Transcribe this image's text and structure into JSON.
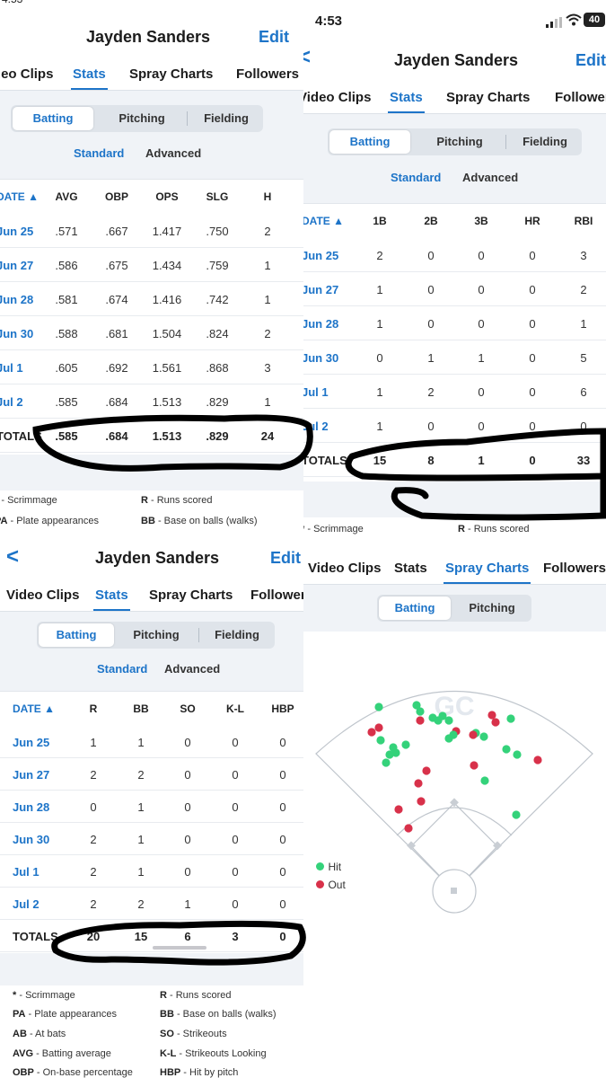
{
  "player_name": "Jayden Sanders",
  "edit_label": "Edit",
  "back_label": "<",
  "status_time": "4:53",
  "battery": "40",
  "tabs": [
    "Video Clips",
    "Stats",
    "Spray Charts",
    "Followers"
  ],
  "seg": [
    "Batting",
    "Pitching",
    "Fielding"
  ],
  "subtabs": [
    "Standard",
    "Advanced"
  ],
  "date_header": "DATE ▲",
  "totals_label": "TOTALS",
  "dates": [
    "Jun 25",
    "Jun 27",
    "Jun 28",
    "Jun 30",
    "Jul 1",
    "Jul 2"
  ],
  "table1": {
    "cols": [
      "AVG",
      "OBP",
      "OPS",
      "SLG",
      "H"
    ],
    "rows": [
      [
        ".571",
        ".667",
        "1.417",
        ".750",
        "2"
      ],
      [
        ".586",
        ".675",
        "1.434",
        ".759",
        "1"
      ],
      [
        ".581",
        ".674",
        "1.416",
        ".742",
        "1"
      ],
      [
        ".588",
        ".681",
        "1.504",
        ".824",
        "2"
      ],
      [
        ".605",
        ".692",
        "1.561",
        ".868",
        "3"
      ],
      [
        ".585",
        ".684",
        "1.513",
        ".829",
        "1"
      ]
    ],
    "totals": [
      ".585",
      ".684",
      "1.513",
      ".829",
      "24"
    ]
  },
  "table2": {
    "cols": [
      "1B",
      "2B",
      "3B",
      "HR",
      "RBI"
    ],
    "rows": [
      [
        "2",
        "0",
        "0",
        "0",
        "3"
      ],
      [
        "1",
        "0",
        "0",
        "0",
        "2"
      ],
      [
        "1",
        "0",
        "0",
        "0",
        "1"
      ],
      [
        "0",
        "1",
        "1",
        "0",
        "5"
      ],
      [
        "1",
        "2",
        "0",
        "0",
        "6"
      ],
      [
        "1",
        "0",
        "0",
        "0",
        "0"
      ]
    ],
    "totals": [
      "15",
      "8",
      "1",
      "0",
      "33"
    ]
  },
  "table3": {
    "cols": [
      "R",
      "BB",
      "SO",
      "K-L",
      "HBP"
    ],
    "rows": [
      [
        "1",
        "1",
        "0",
        "0",
        "0"
      ],
      [
        "2",
        "2",
        "0",
        "0",
        "0"
      ],
      [
        "0",
        "1",
        "0",
        "0",
        "0"
      ],
      [
        "2",
        "1",
        "0",
        "0",
        "0"
      ],
      [
        "2",
        "1",
        "0",
        "0",
        "0"
      ],
      [
        "2",
        "2",
        "1",
        "0",
        "0"
      ]
    ],
    "totals": [
      "20",
      "15",
      "6",
      "3",
      "0"
    ]
  },
  "legend": {
    "scrimmage": [
      "* ",
      "- Scrimmage"
    ],
    "pa": [
      "PA",
      " - Plate appearances"
    ],
    "ab": [
      "AB",
      " - At bats"
    ],
    "avg": [
      "AVG",
      " - Batting average"
    ],
    "obp": [
      "OBP",
      " - On-base percentage"
    ],
    "r": [
      "R",
      " - Runs scored"
    ],
    "bb": [
      "BB",
      " - Base on balls (walks)"
    ],
    "so": [
      "SO",
      " - Strikeouts"
    ],
    "kl": [
      "K-L",
      " - Strikeouts Looking"
    ],
    "hbp": [
      "HBP",
      " - Hit by pitch"
    ]
  },
  "spray": {
    "seg": [
      "Batting",
      "Pitching"
    ],
    "hit_label": "Hit",
    "out_label": "Out",
    "hit_color": "#34d27a",
    "out_color": "#d8314a",
    "logo_text": "GC"
  }
}
